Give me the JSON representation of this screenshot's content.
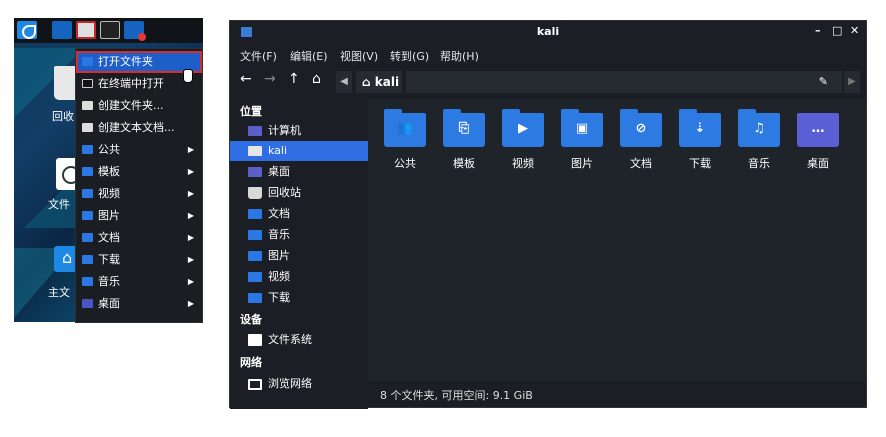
{
  "desktop": {
    "icon_labels": [
      "回收",
      "文件",
      "主文"
    ]
  },
  "context_menu": {
    "items": [
      {
        "label": "打开文件夹",
        "icon": "open-icon",
        "submenu": false
      },
      {
        "label": "在终端中打开",
        "icon": "terminal-icon",
        "submenu": false
      },
      {
        "label": "创建文件夹...",
        "icon": "new-folder-icon",
        "submenu": false
      },
      {
        "label": "创建文本文档...",
        "icon": "new-doc-icon",
        "submenu": false
      },
      {
        "label": "公共",
        "icon": "folder-icon",
        "submenu": true
      },
      {
        "label": "模板",
        "icon": "folder-icon",
        "submenu": true
      },
      {
        "label": "视频",
        "icon": "folder-icon",
        "submenu": true
      },
      {
        "label": "图片",
        "icon": "folder-icon",
        "submenu": true
      },
      {
        "label": "文档",
        "icon": "folder-icon",
        "submenu": true
      },
      {
        "label": "下载",
        "icon": "folder-icon",
        "submenu": true
      },
      {
        "label": "音乐",
        "icon": "folder-icon",
        "submenu": true
      },
      {
        "label": "桌面",
        "icon": "desktop-icon",
        "submenu": true
      }
    ],
    "submenu_arrow": "▶"
  },
  "window": {
    "title": "kali",
    "min": "–",
    "max": "□",
    "close": "✕"
  },
  "menubar": [
    "文件(F)",
    "编辑(E)",
    "视图(V)",
    "转到(G)",
    "帮助(H)"
  ],
  "toolbar": {
    "back": "←",
    "forward": "→",
    "up": "↑",
    "home": "⌂",
    "crumb_left": "◀",
    "crumb_home_label": "kali",
    "crumb_home_glyph": "⌂",
    "edit_glyph": "✎",
    "crumb_right": "▶"
  },
  "sidebar": {
    "places_header": "位置",
    "places": [
      {
        "label": "计算机",
        "icon": "computer-icon"
      },
      {
        "label": "kali",
        "icon": "home-folder-icon"
      },
      {
        "label": "桌面",
        "icon": "desktop-icon"
      },
      {
        "label": "回收站",
        "icon": "trash-icon"
      },
      {
        "label": "文档",
        "icon": "documents-icon"
      },
      {
        "label": "音乐",
        "icon": "music-icon"
      },
      {
        "label": "图片",
        "icon": "pictures-icon"
      },
      {
        "label": "视频",
        "icon": "videos-icon"
      },
      {
        "label": "下载",
        "icon": "downloads-icon"
      }
    ],
    "devices_header": "设备",
    "devices": [
      {
        "label": "文件系统",
        "icon": "disk-icon"
      }
    ],
    "network_header": "网络",
    "network": [
      {
        "label": "浏览网络",
        "icon": "network-icon"
      }
    ]
  },
  "files": [
    {
      "label": "公共",
      "icon": "public-folder-icon",
      "glyph": "👥"
    },
    {
      "label": "模板",
      "icon": "templates-folder-icon",
      "glyph": "⎘"
    },
    {
      "label": "视频",
      "icon": "videos-folder-icon",
      "glyph": "▶"
    },
    {
      "label": "图片",
      "icon": "pictures-folder-icon",
      "glyph": "▣"
    },
    {
      "label": "文档",
      "icon": "documents-folder-icon",
      "glyph": "⊘"
    },
    {
      "label": "下载",
      "icon": "downloads-folder-icon",
      "glyph": "⇣"
    },
    {
      "label": "音乐",
      "icon": "music-folder-icon",
      "glyph": "♫"
    },
    {
      "label": "桌面",
      "icon": "desktop-folder-icon",
      "glyph": "…"
    }
  ],
  "status": "8 个文件夹, 可用空间: 9.1 GiB"
}
